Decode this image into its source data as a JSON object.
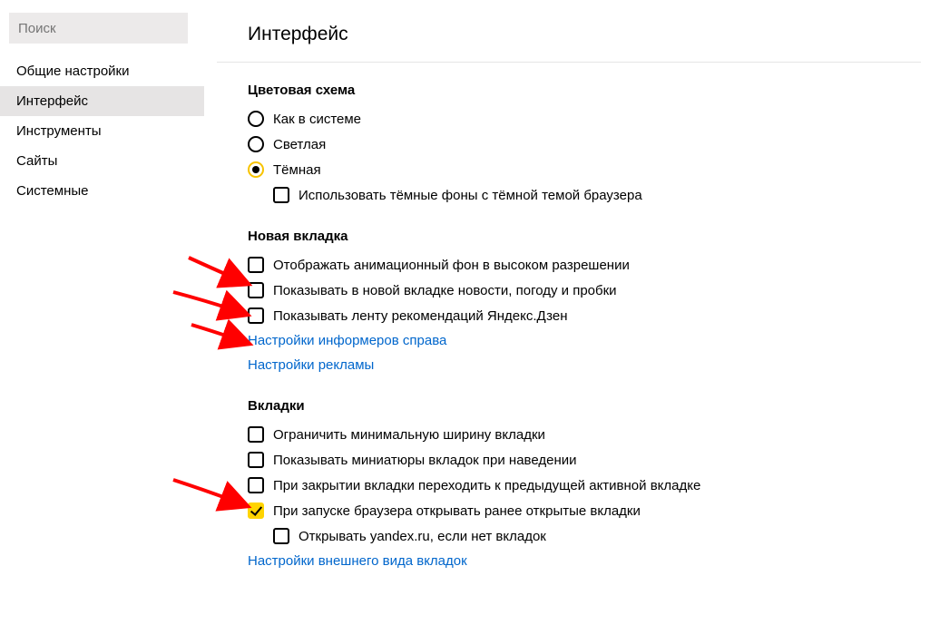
{
  "sidebar": {
    "search_placeholder": "Поиск",
    "items": [
      {
        "label": "Общие настройки",
        "active": false
      },
      {
        "label": "Интерфейс",
        "active": true
      },
      {
        "label": "Инструменты",
        "active": false
      },
      {
        "label": "Сайты",
        "active": false
      },
      {
        "label": "Системные",
        "active": false
      }
    ]
  },
  "page": {
    "title": "Интерфейс"
  },
  "section_color": {
    "title": "Цветовая схема",
    "options": [
      {
        "label": "Как в системе",
        "selected": false
      },
      {
        "label": "Светлая",
        "selected": false
      },
      {
        "label": "Тёмная",
        "selected": true
      }
    ],
    "dark_bg_checkbox": {
      "label": "Использовать тёмные фоны с тёмной темой браузера",
      "checked": false
    }
  },
  "section_newtab": {
    "title": "Новая вкладка",
    "checkboxes": [
      {
        "label": "Отображать анимационный фон в высоком разрешении",
        "checked": false
      },
      {
        "label": "Показывать в новой вкладке новости, погоду и пробки",
        "checked": false
      },
      {
        "label": "Показывать ленту рекомендаций Яндекс.Дзен",
        "checked": false
      }
    ],
    "links": [
      "Настройки информеров справа",
      "Настройки рекламы"
    ]
  },
  "section_tabs": {
    "title": "Вкладки",
    "checkboxes": [
      {
        "label": "Ограничить минимальную ширину вкладки",
        "checked": false
      },
      {
        "label": "Показывать миниатюры вкладок при наведении",
        "checked": false
      },
      {
        "label": "При закрытии вкладки переходить к предыдущей активной вкладке",
        "checked": false
      },
      {
        "label": "При запуске браузера открывать ранее открытые вкладки",
        "checked": true
      }
    ],
    "sub_checkbox": {
      "label": "Открывать yandex.ru, если нет вкладок",
      "checked": false
    },
    "link": "Настройки внешнего вида вкладок"
  }
}
